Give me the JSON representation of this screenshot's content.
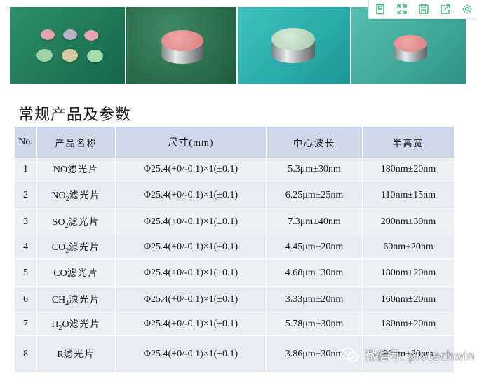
{
  "heading": "常规产品及参数",
  "table": {
    "headers": [
      "No.",
      "产品名称",
      "尺寸(mm)",
      "中心波长",
      "半高宽"
    ],
    "rows": [
      {
        "no": "1",
        "gas": "NO",
        "sub": "",
        "gas_after": "",
        "suffix": "滤光片",
        "size": "Φ25.4(+0/-0.1)×1(±0.1)",
        "center": "5.3μm±30nm",
        "fwhm": "180nm±20nm"
      },
      {
        "no": "2",
        "gas": "NO",
        "sub": "2",
        "gas_after": "",
        "suffix": "滤光片",
        "size": "Φ25.4(+0/-0.1)×1(±0.1)",
        "center": "6.25μm±25nm",
        "fwhm": "110nm±15nm"
      },
      {
        "no": "3",
        "gas": "SO",
        "sub": "2",
        "gas_after": "",
        "suffix": "滤光片",
        "size": "Φ25.4(+0/-0.1)×1(±0.1)",
        "center": "7.3μm±40nm",
        "fwhm": "200nm±30nm"
      },
      {
        "no": "4",
        "gas": "CO",
        "sub": "2",
        "gas_after": "",
        "suffix": "滤光片",
        "size": "Φ25.4(+0/-0.1)×1(±0.1)",
        "center": "4.45μm±20nm",
        "fwhm": "60nm±20nm"
      },
      {
        "no": "5",
        "gas": "CO",
        "sub": "",
        "gas_after": "",
        "suffix": "滤光片",
        "size": "Φ25.4(+0/-0.1)×1(±0.1)",
        "center": "4.68μm±30nm",
        "fwhm": "180nm±20nm"
      },
      {
        "no": "6",
        "gas": "CH",
        "sub": "4",
        "gas_after": "",
        "suffix": "滤光片",
        "size": "Φ25.4(+0/-0.1)×1(±0.1)",
        "center": "3.33μm±20nm",
        "fwhm": "160nm±20nm"
      },
      {
        "no": "7",
        "gas": "H",
        "sub": "2",
        "gas_after": "O",
        "suffix": "滤光片",
        "size": "Φ25.4(+0/-0.1)×1(±0.1)",
        "center": "5.78μm±30nm",
        "fwhm": "180nm±20nm"
      },
      {
        "no": "8",
        "gas": "R",
        "sub": "",
        "gas_after": "",
        "suffix": "滤光片",
        "size": "Φ25.4(+0/-0.1)×1(±0.1)",
        "center": "3.86μm±30nm",
        "fwhm": "90nm±20nm"
      }
    ]
  },
  "watermark": "微信号: protechwin",
  "toolbar_icons": [
    "bookmark-icon",
    "expand-icon",
    "save-icon",
    "share-icon",
    "settings-icon"
  ],
  "colors": {
    "header_bg": "#cdd8e8",
    "row_bg": "#edf0f5"
  }
}
